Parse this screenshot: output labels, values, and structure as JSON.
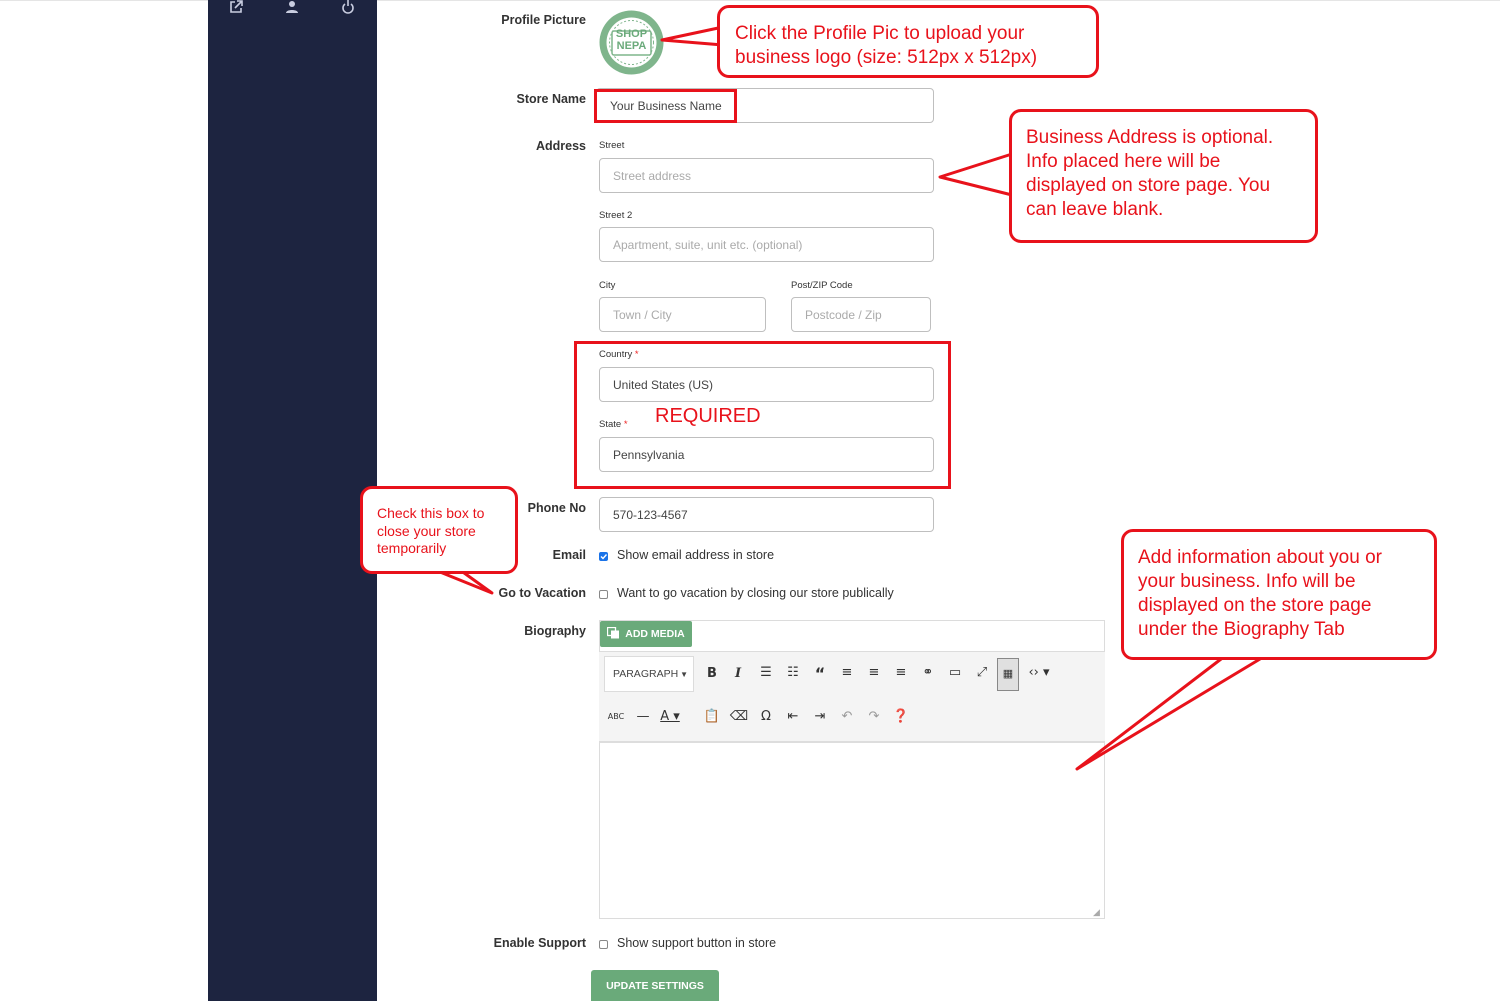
{
  "sidebar": {
    "icons": [
      "external-link-icon",
      "user-icon",
      "power-icon"
    ]
  },
  "form": {
    "profile_picture_label": "Profile Picture",
    "logo_line1": "SHOP",
    "logo_line2": "NEPA",
    "store_name_label": "Store Name",
    "store_name_value": "Your Business Name",
    "address_label": "Address",
    "street_label": "Street",
    "street_placeholder": "Street address",
    "street2_label": "Street 2",
    "street2_placeholder": "Apartment, suite, unit etc. (optional)",
    "city_label": "City",
    "city_placeholder": "Town / City",
    "zip_label": "Post/ZIP Code",
    "zip_placeholder": "Postcode / Zip",
    "country_label": "Country",
    "country_value": "United States (US)",
    "state_label": "State",
    "state_value": "Pennsylvania",
    "required_marker": "*",
    "phone_label": "Phone No",
    "phone_value": "570-123-4567",
    "email_label": "Email",
    "email_checkbox_text": "Show email address in store",
    "email_checked": true,
    "vacation_label": "Go to Vacation",
    "vacation_checkbox_text": "Want to go vacation by closing our store publically",
    "vacation_checked": false,
    "biography_label": "Biography",
    "add_media_label": "ADD MEDIA",
    "paragraph_select": "PARAGRAPH",
    "support_label": "Enable Support",
    "support_checkbox_text": "Show support button in store",
    "support_checked": false,
    "update_button": "UPDATE SETTINGS"
  },
  "annotations": {
    "profile_callout": "Click the Profile Pic to upload your business logo (size: 512px x 512px)",
    "address_callout": "Business Address is optional. Info placed here will be displayed on store page. You can leave blank.",
    "required_text": "REQUIRED",
    "vacation_callout": "Check this box to close your store temporarily",
    "biography_callout": "Add information about you or your business. Info will be displayed on the store page under the Biography Tab"
  },
  "colors": {
    "sidebar": "#1d2440",
    "annotation_red": "#e8121b",
    "accent_green": "#6aaa7a",
    "checkbox_blue": "#1a73e8"
  }
}
